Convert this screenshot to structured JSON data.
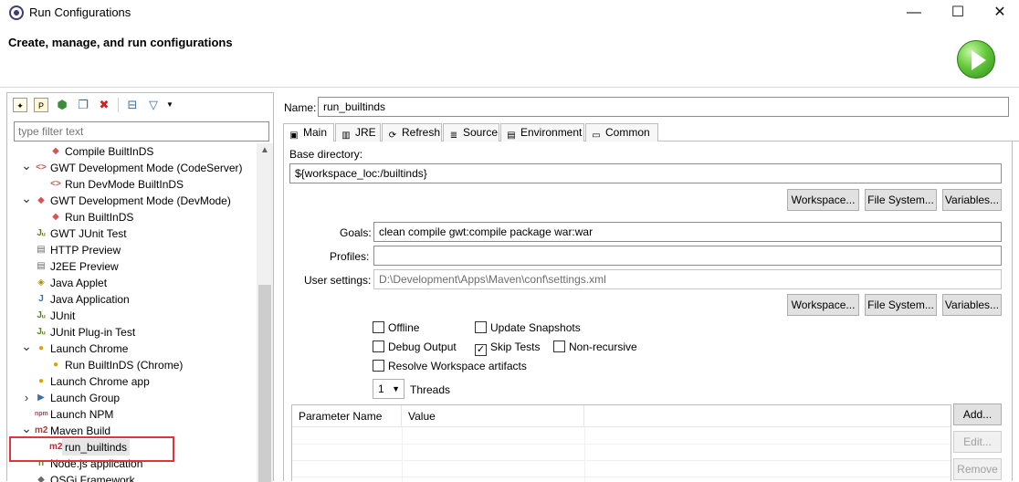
{
  "window": {
    "title": "Run Configurations",
    "heading": "Create, manage, and run configurations",
    "controls": [
      "—",
      "☐",
      "✕"
    ]
  },
  "left": {
    "filter_placeholder": "type filter text",
    "tree": [
      {
        "label": "Compile BuiltInDS",
        "level": 1,
        "expand": "",
        "icon": "gwt-run-icon",
        "glyph": "◆",
        "color": "#d9534f"
      },
      {
        "label": "GWT Development Mode (CodeServer)",
        "level": 0,
        "expand": "v",
        "icon": "gwt-codeserver-icon",
        "glyph": "<>",
        "color": "#d9534f"
      },
      {
        "label": "Run DevMode BuiltInDS",
        "level": 1,
        "expand": "",
        "icon": "gwt-codeserver-icon",
        "glyph": "<>",
        "color": "#d9534f"
      },
      {
        "label": "GWT Development Mode (DevMode)",
        "level": 0,
        "expand": "v",
        "icon": "gwt-devmode-icon",
        "glyph": "◆",
        "color": "#d9534f"
      },
      {
        "label": "Run BuiltInDS",
        "level": 1,
        "expand": "",
        "icon": "gwt-devmode-icon",
        "glyph": "◆",
        "color": "#d9534f"
      },
      {
        "label": "GWT JUnit Test",
        "level": 0,
        "expand": "",
        "icon": "junit-icon",
        "glyph": "Jᵤ",
        "color": "#5a7d2a"
      },
      {
        "label": "HTTP Preview",
        "level": 0,
        "expand": "",
        "icon": "http-preview-icon",
        "glyph": "▤",
        "color": "#6b6b6b"
      },
      {
        "label": "J2EE Preview",
        "level": 0,
        "expand": "",
        "icon": "j2ee-preview-icon",
        "glyph": "▤",
        "color": "#6b6b6b"
      },
      {
        "label": "Java Applet",
        "level": 0,
        "expand": "",
        "icon": "java-applet-icon",
        "glyph": "◈",
        "color": "#b08a00"
      },
      {
        "label": "Java Application",
        "level": 0,
        "expand": "",
        "icon": "java-application-icon",
        "glyph": "J",
        "color": "#3a6ea5"
      },
      {
        "label": "JUnit",
        "level": 0,
        "expand": "",
        "icon": "junit-icon",
        "glyph": "Jᵤ",
        "color": "#5a7d2a"
      },
      {
        "label": "JUnit Plug-in Test",
        "level": 0,
        "expand": "",
        "icon": "junit-plugin-icon",
        "glyph": "Jᵤ",
        "color": "#5a7d2a"
      },
      {
        "label": "Launch Chrome",
        "level": 0,
        "expand": "v",
        "icon": "chrome-icon",
        "glyph": "●",
        "color": "#e0a200"
      },
      {
        "label": "Run BuiltInDS (Chrome)",
        "level": 1,
        "expand": "",
        "icon": "chrome-icon",
        "glyph": "●",
        "color": "#e0a200"
      },
      {
        "label": "Launch Chrome app",
        "level": 0,
        "expand": "",
        "icon": "chrome-app-icon",
        "glyph": "●",
        "color": "#e0a200"
      },
      {
        "label": "Launch Group",
        "level": 0,
        "expand": ">",
        "icon": "launch-group-icon",
        "glyph": "▶",
        "color": "#3a6ea5"
      },
      {
        "label": "Launch NPM",
        "level": 0,
        "expand": "",
        "icon": "npm-icon",
        "glyph": "npm",
        "color": "#cb3837"
      },
      {
        "label": "Maven Build",
        "level": 0,
        "expand": "v",
        "icon": "maven-icon",
        "glyph": "m2",
        "color": "#b03a2e"
      },
      {
        "label": "run_builtinds",
        "level": 1,
        "expand": "",
        "icon": "maven-icon",
        "glyph": "m2",
        "color": "#d9202f",
        "selected": true
      },
      {
        "label": "Node.js application",
        "level": 0,
        "expand": "",
        "icon": "nodejs-icon",
        "glyph": "n",
        "color": "#5a8a2a"
      },
      {
        "label": "OSGi Framework",
        "level": 0,
        "expand": "",
        "icon": "osgi-icon",
        "glyph": "◆",
        "color": "#6b6b6b"
      }
    ]
  },
  "right": {
    "name_label": "Name:",
    "name_value": "run_builtinds",
    "tabs": [
      {
        "label": "Main",
        "icon": "main-tab-icon",
        "glyph": "▣"
      },
      {
        "label": "JRE",
        "icon": "jre-tab-icon",
        "glyph": "▥"
      },
      {
        "label": "Refresh",
        "icon": "refresh-tab-icon",
        "glyph": "⟳"
      },
      {
        "label": "Source",
        "icon": "source-tab-icon",
        "glyph": "≣"
      },
      {
        "label": "Environment",
        "icon": "environment-tab-icon",
        "glyph": "▤"
      },
      {
        "label": "Common",
        "icon": "common-tab-icon",
        "glyph": "▭"
      }
    ],
    "base_dir_label": "Base directory:",
    "base_dir_value": "${workspace_loc:/builtinds}",
    "buttons_row1": [
      "Workspace...",
      "File System...",
      "Variables..."
    ],
    "goals_label": "Goals:",
    "goals_value": "clean compile gwt:compile package war:war",
    "profiles_label": "Profiles:",
    "profiles_value": "",
    "user_settings_label": "User settings:",
    "user_settings_value": "D:\\Development\\Apps\\Maven\\conf\\settings.xml",
    "buttons_row2": [
      "Workspace...",
      "File System...",
      "Variables..."
    ],
    "checkboxes": [
      {
        "label": "Offline",
        "checked": false
      },
      {
        "label": "Update Snapshots",
        "checked": false
      },
      {
        "label": "Debug Output",
        "checked": false
      },
      {
        "label": "Skip Tests",
        "checked": true
      },
      {
        "label": "Non-recursive",
        "checked": false
      },
      {
        "label": "Resolve Workspace artifacts",
        "checked": false
      }
    ],
    "threads_value": "1",
    "threads_label": "Threads",
    "param_columns": [
      "Parameter Name",
      "Value"
    ],
    "param_buttons": [
      "Add...",
      "Edit...",
      "Remove"
    ]
  }
}
